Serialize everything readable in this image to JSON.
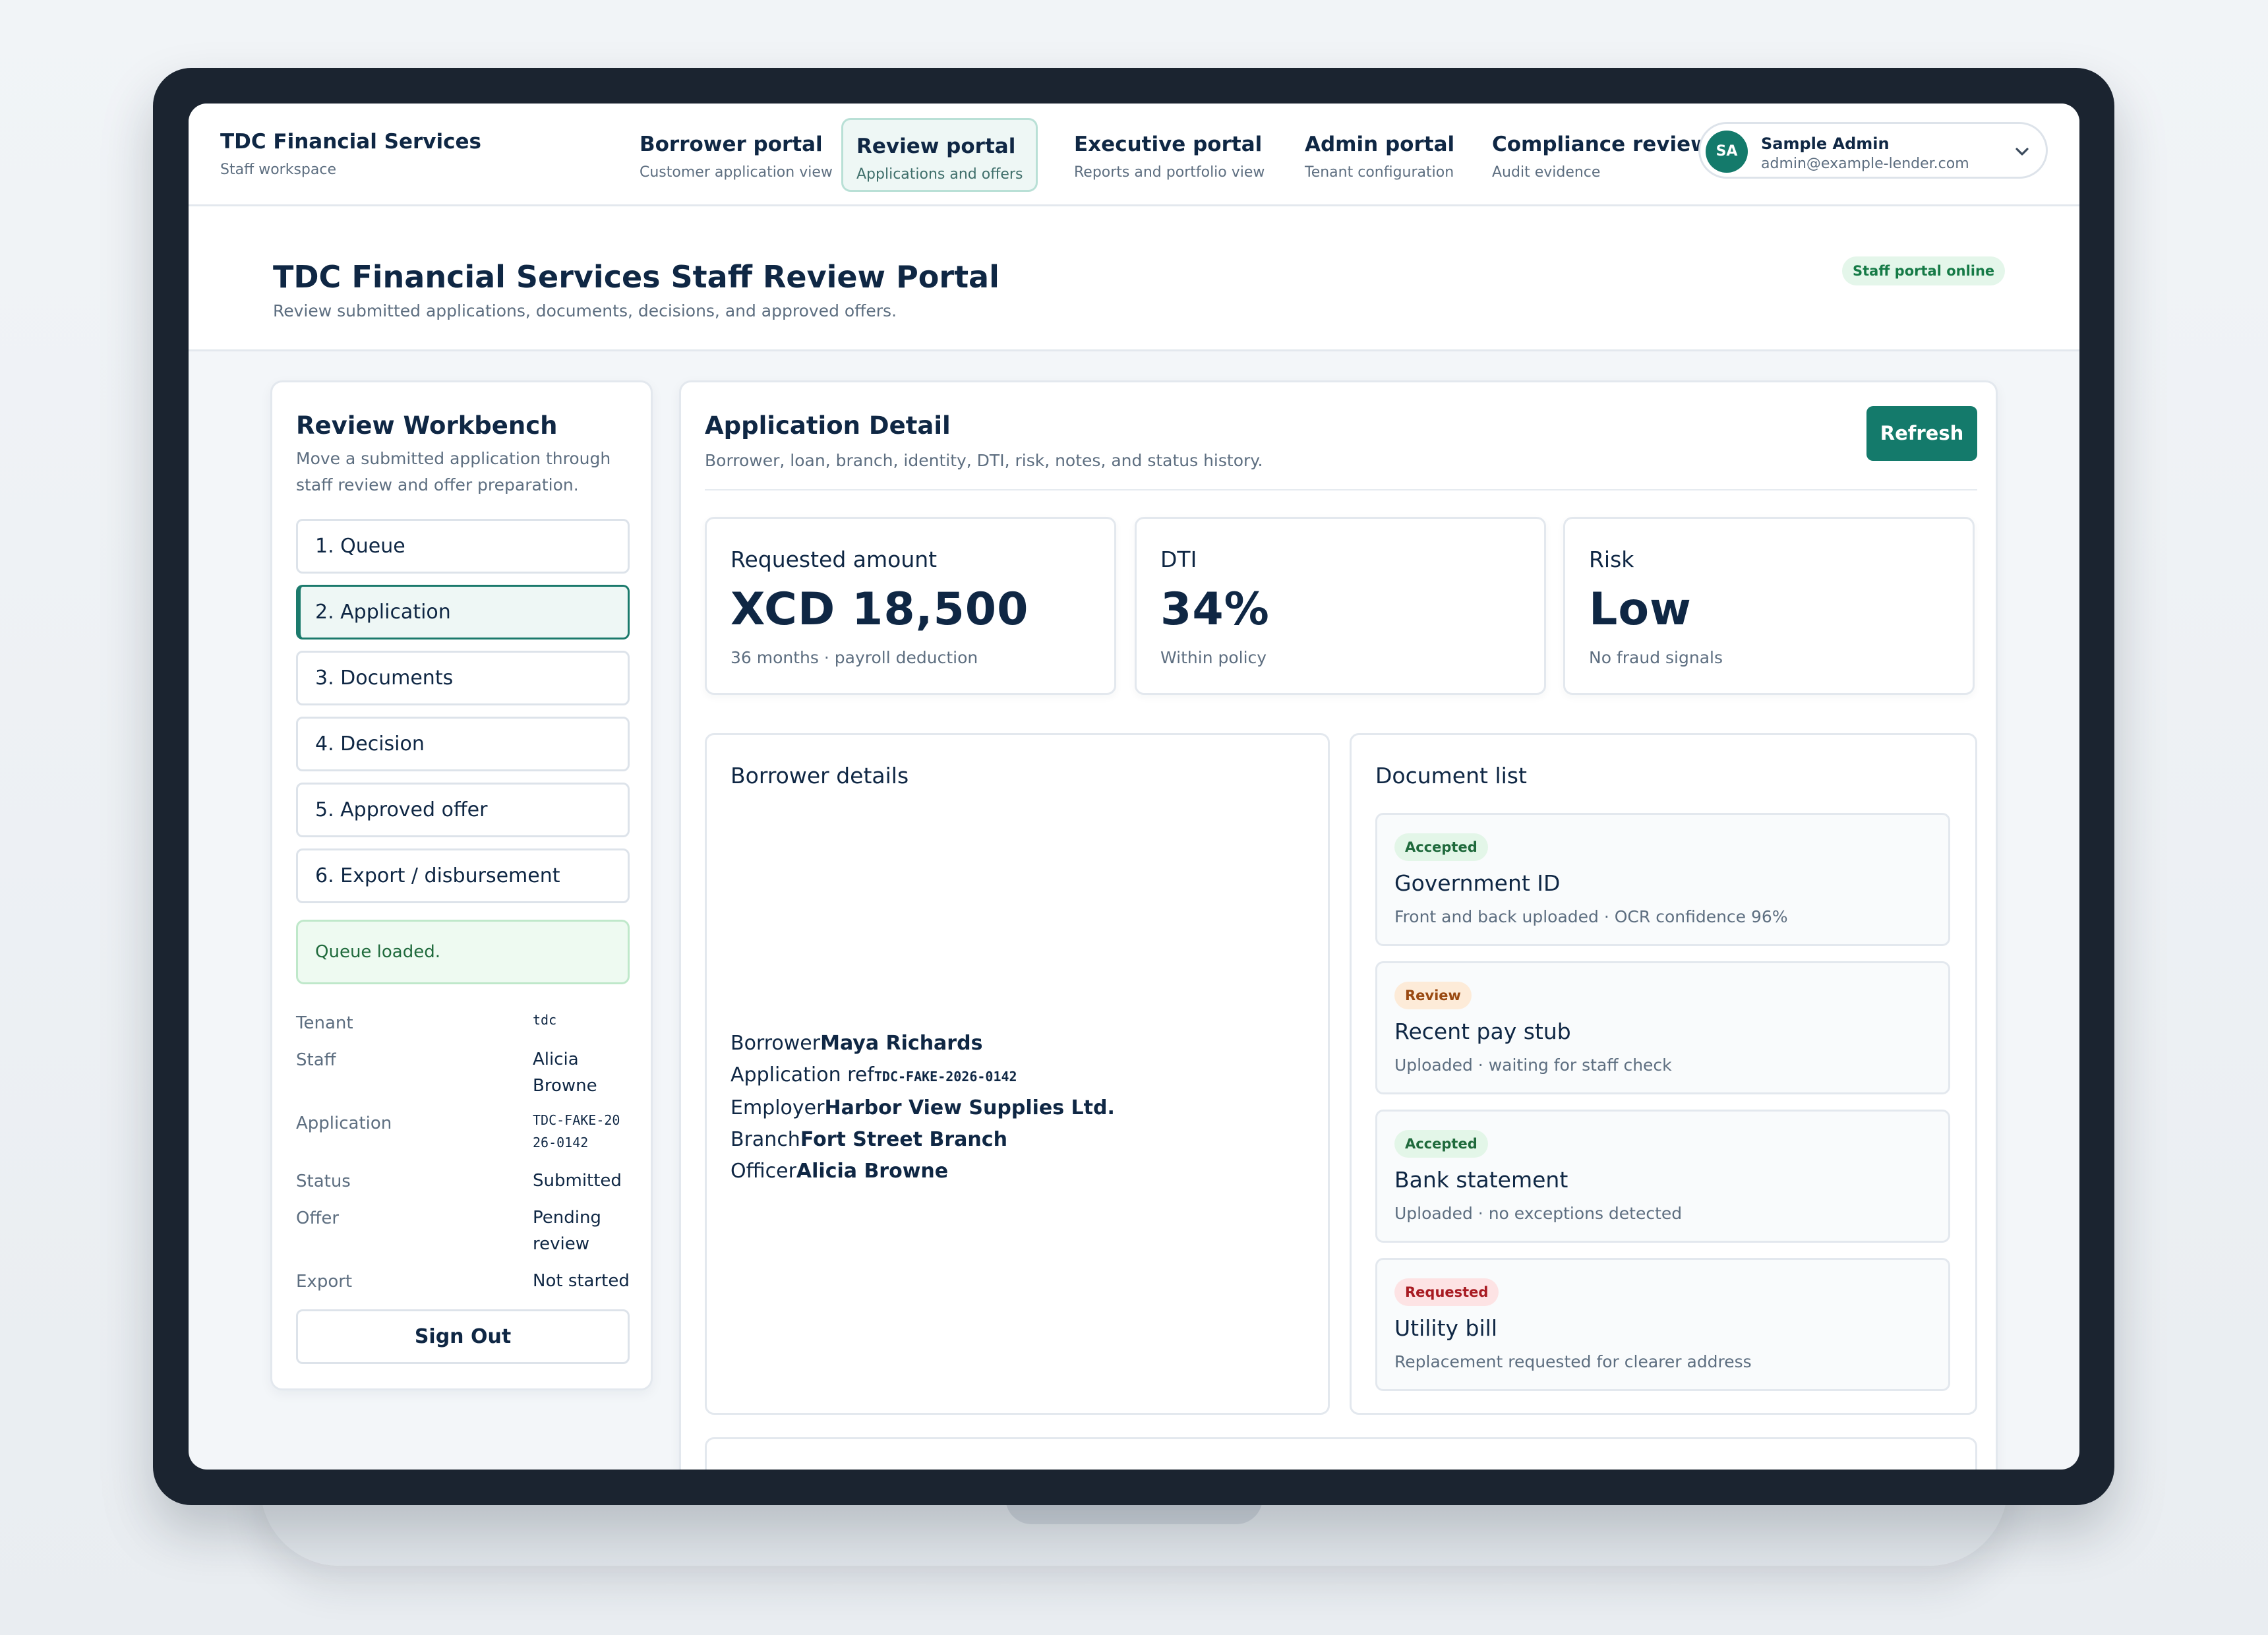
{
  "nav": {
    "brand_title": "TDC Financial Services",
    "brand_sub": "Staff workspace",
    "tabs": [
      {
        "title": "Borrower portal",
        "sub": "Customer application view"
      },
      {
        "title": "Review portal",
        "sub": "Applications and offers",
        "active": true
      },
      {
        "title": "Executive portal",
        "sub": "Reports and portfolio view"
      },
      {
        "title": "Admin portal",
        "sub": "Tenant configuration"
      },
      {
        "title": "Compliance review",
        "sub": "Audit evidence"
      }
    ],
    "user": {
      "initials": "SA",
      "name": "Sample Admin",
      "email": "admin@example-lender.com"
    }
  },
  "header": {
    "title": "TDC Financial Services Staff Review Portal",
    "subtitle": "Review submitted applications, documents, decisions, and approved offers.",
    "status_badge": "Staff portal online"
  },
  "sidebar": {
    "title": "Review Workbench",
    "subtitle": "Move a submitted application through staff review and offer preparation.",
    "steps": [
      "1. Queue",
      "2. Application",
      "3. Documents",
      "4. Decision",
      "5. Approved offer",
      "6. Export / disbursement"
    ],
    "active_step": "2. Application",
    "status_message": "Queue loaded.",
    "meta": [
      {
        "label": "Tenant",
        "value": "tdc"
      },
      {
        "label": "Staff",
        "value": "Alicia Browne"
      },
      {
        "label": "Application",
        "value": "TDC-FAKE-2026-0142"
      },
      {
        "label": "Status",
        "value": "Submitted"
      },
      {
        "label": "Offer",
        "value": "Pending review"
      },
      {
        "label": "Export",
        "value": "Not started"
      }
    ],
    "sign_out": "Sign Out"
  },
  "main": {
    "title": "Application Detail",
    "subtitle": "Borrower, loan, branch, identity, DTI, risk, notes, and status history.",
    "refresh": "Refresh",
    "stats": [
      {
        "label": "Requested amount",
        "value": "XCD 18,500",
        "note": "36 months · payroll deduction"
      },
      {
        "label": "DTI",
        "value": "34%",
        "note": "Within policy"
      },
      {
        "label": "Risk",
        "value": "Low",
        "note": "No fraud signals"
      }
    ],
    "borrower_panel": {
      "title": "Borrower details",
      "rows": [
        {
          "label": "Borrower",
          "value": "Maya Richards"
        },
        {
          "label": "Application ref",
          "value": "TDC-FAKE-2026-0142"
        },
        {
          "label": "Employer",
          "value": "Harbor View Supplies Ltd."
        },
        {
          "label": "Branch",
          "value": "Fort Street Branch"
        },
        {
          "label": "Officer",
          "value": "Alicia Browne"
        }
      ]
    },
    "documents_panel": {
      "title": "Document list",
      "docs": [
        {
          "status": "Accepted",
          "title": "Government ID",
          "note": "Front and back uploaded · OCR confidence 96%"
        },
        {
          "status": "Review",
          "title": "Recent pay stub",
          "note": "Uploaded · waiting for staff check"
        },
        {
          "status": "Accepted",
          "title": "Bank statement",
          "note": "Uploaded · no exceptions detected"
        },
        {
          "status": "Requested",
          "title": "Utility bill",
          "note": "Replacement requested for clearer address"
        }
      ]
    }
  },
  "colors": {
    "accent": "#147a6b",
    "navy": "#0f2744",
    "muted": "#5d6e80",
    "bezel": "#1b2430"
  }
}
